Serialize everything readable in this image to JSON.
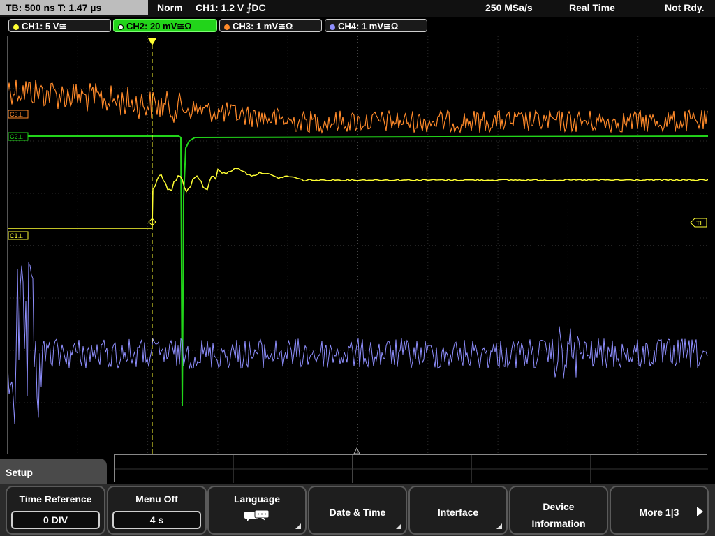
{
  "status_bar": {
    "timebase": "TB: 500 ns   T: 1.47 µs",
    "trigger_mode": "Norm",
    "trigger_info": "CH1: 1.2 V ⨍DC",
    "sample_rate": "250 MSa/s",
    "acq_mode": "Real Time",
    "ready_state": "Not Rdy."
  },
  "channels": [
    {
      "label": "CH1: 5 V≅",
      "color": "#ffff33"
    },
    {
      "label": "CH2: 20 mV≅Ω",
      "color": "#22d41a",
      "active": true
    },
    {
      "label": "CH3: 1 mV≅Ω",
      "color": "#ff8a2a"
    },
    {
      "label": "CH4: 1 mV≅Ω",
      "color": "#8f8fff"
    }
  ],
  "markers": {
    "c3": "C3⊥",
    "c2": "C2⊥",
    "c1": "C1⊥",
    "trigger_level": "TL",
    "trigger_pos": "T"
  },
  "menu": {
    "title": "Setup",
    "softkeys": [
      {
        "label": "Time Reference",
        "value": "0 DIV"
      },
      {
        "label": "Menu Off",
        "value": "4 s"
      },
      {
        "label": "Language",
        "icon": "speech-bubble-icon"
      },
      {
        "label": "Date & Time"
      },
      {
        "label": "Interface"
      },
      {
        "label": "Device\nInformation"
      },
      {
        "label": "More 1|3",
        "icon": "arrow-right-icon"
      }
    ]
  }
}
